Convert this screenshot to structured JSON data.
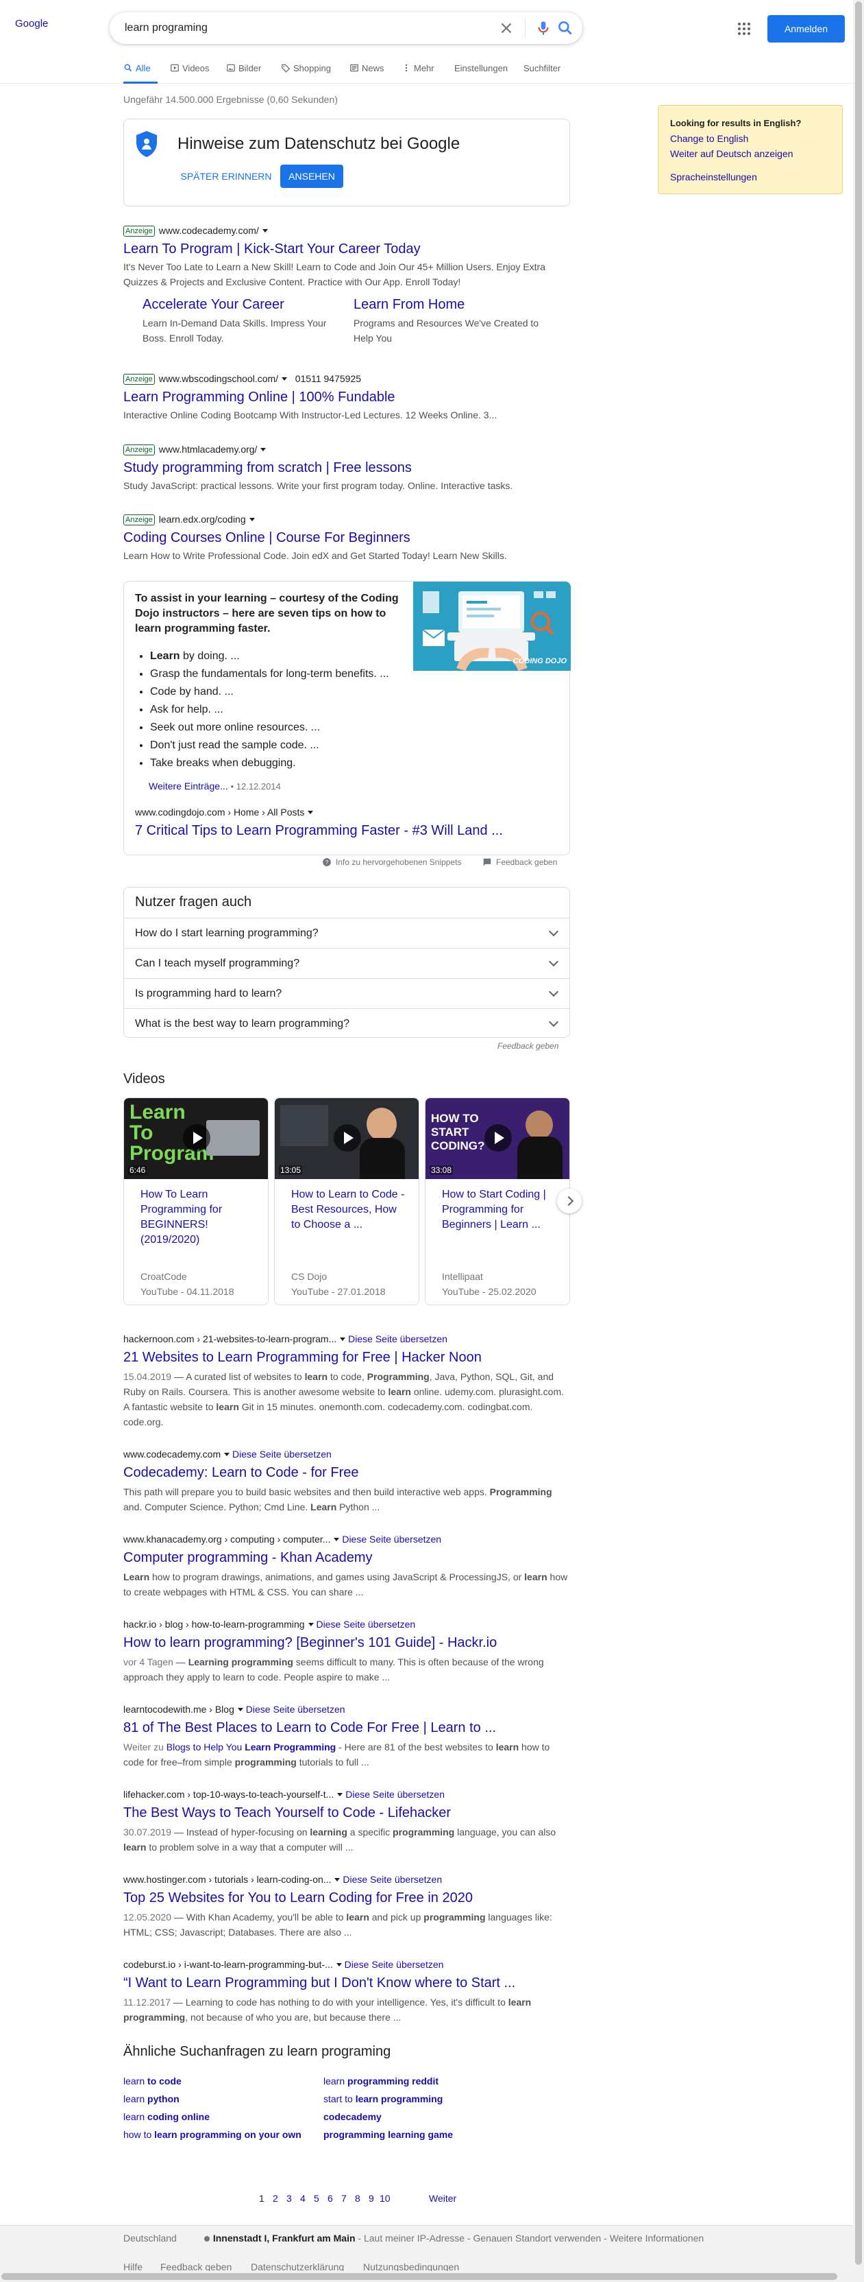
{
  "header": {
    "logo_alt": "Google",
    "query": "learn programing",
    "signin_label": "Anmelden"
  },
  "tabs": [
    {
      "label": "Alle"
    },
    {
      "label": "Videos"
    },
    {
      "label": "Bilder"
    },
    {
      "label": "Shopping"
    },
    {
      "label": "News"
    },
    {
      "label": "Mehr"
    },
    {
      "label": "Einstellungen"
    },
    {
      "label": "Suchfilter"
    }
  ],
  "stats": "Ungefähr 14.500.000 Ergebnisse (0,60 Sekunden)",
  "privacy": {
    "title": "Hinweise zum Datenschutz bei Google",
    "later": "SPÄTER ERINNERN",
    "view": "ANSEHEN"
  },
  "side_panel": {
    "title": "Looking for results in English?",
    "link1": "Change to English",
    "link2": "Weiter auf Deutsch anzeigen",
    "link3": "Spracheinstellungen"
  },
  "ads": [
    {
      "badge": "Anzeige",
      "url": "www.codecademy.com/",
      "phone": "",
      "title": "Learn To Program | Kick-Start Your Career Today",
      "desc": "It's Never Too Late to Learn a New Skill! Learn to Code and Join Our 45+ Million Users. Enjoy Extra Quizzes & Projects and Exclusive Content. Practice with Our App. Enroll Today!",
      "sitelinks": [
        {
          "title": "Accelerate Your Career",
          "desc": "Learn In-Demand Data Skills. Impress Your Boss. Enroll Today."
        },
        {
          "title": "Learn From Home",
          "desc": "Programs and Resources We've Created to Help You"
        }
      ]
    },
    {
      "badge": "Anzeige",
      "url": "www.wbscodingschool.com/",
      "phone": "01511 9475925",
      "title": "Learn Programming Online | 100% Fundable",
      "desc": "Interactive Online Coding Bootcamp With Instructor-Led Lectures. 12 Weeks Online. 3..."
    },
    {
      "badge": "Anzeige",
      "url": "www.htmlacademy.org/",
      "phone": "",
      "title": "Study programming from scratch | Free lessons",
      "desc": "Study JavaScript: practical lessons. Write your first program today. Online. Interactive tasks."
    },
    {
      "badge": "Anzeige",
      "url": "learn.edx.org/coding",
      "phone": "",
      "title": "Coding Courses Online | Course For Beginners",
      "desc": "Learn How to Write Professional Code. Join edX and Get Started Today! Learn New Skills."
    }
  ],
  "snippet": {
    "heading": "To assist in your learning – courtesy of the Coding Dojo instructors – here are seven tips on how to learn programming faster.",
    "tips": [
      "Learn by doing. ...",
      "Grasp the fundamentals for long-term benefits. ...",
      "Code by hand. ...",
      "Ask for help. ...",
      "Seek out more online resources. ...",
      "Don't just read the sample code. ...",
      "Take breaks when debugging."
    ],
    "more": "Weitere Einträge...",
    "date": "12.12.2014",
    "cite": "www.codingdojo.com › Home › All Posts",
    "link": "7 Critical Tips to Learn Programming Faster - #3 Will Land ...",
    "image_label": "CODING DOJO",
    "about": "Info zu hervorgehobenen Snippets",
    "feedback": "Feedback geben"
  },
  "paa": {
    "heading": "Nutzer fragen auch",
    "questions": [
      "How do I start learning programming?",
      "Can I teach myself programming?",
      "Is programming hard to learn?",
      "What is the best way to learn programming?"
    ],
    "feedback": "Feedback geben"
  },
  "videos": {
    "heading": "Videos",
    "items": [
      {
        "title": "How To Learn Programming for BEGINNERS! (2019/2020)",
        "channel": "CroatCode",
        "source": "YouTube",
        "date": "04.11.2018",
        "duration": "6:46",
        "thumb_text": "Learn To Program"
      },
      {
        "title": "How to Learn to Code - Best Resources, How to Choose a ...",
        "channel": "CS Dojo",
        "source": "YouTube",
        "date": "27.01.2018",
        "duration": "13:05",
        "thumb_text": ""
      },
      {
        "title": "How to Start Coding | Programming for Beginners | Learn ...",
        "channel": "Intellipaat",
        "source": "YouTube",
        "date": "25.02.2020",
        "duration": "33:08",
        "thumb_text": "HOW TO START CODING?"
      }
    ]
  },
  "results": [
    {
      "cite": "hackernoon.com › 21-websites-to-learn-program...",
      "translate": "Diese Seite übersetzen",
      "title": "21 Websites to Learn Programming for Free | Hacker Noon",
      "date": "15.04.2019",
      "desc": "A curated list of websites to learn to code, Programming, Java, Python, SQL, Git, and Ruby on Rails. Coursera. This is another awesome website to learn online. udemy.com. plurasight.com. A fantastic website to learn Git in 15 minutes. onemonth.com. codecademy.com. codingbat.com. code.org."
    },
    {
      "cite": "www.codecademy.com",
      "translate": "Diese Seite übersetzen",
      "title": "Codecademy: Learn to Code - for Free",
      "date": "",
      "desc": "This path will prepare you to build basic websites and then build interactive web apps. Programming and. Computer Science. Python; Cmd Line. Learn Python ..."
    },
    {
      "cite": "www.khanacademy.org › computing › computer...",
      "translate": "Diese Seite übersetzen",
      "title": "Computer programming - Khan Academy",
      "date": "",
      "desc": "Learn how to program drawings, animations, and games using JavaScript & ProcessingJS, or learn how to create webpages with HTML & CSS. You can share ..."
    },
    {
      "cite": "hackr.io › blog › how-to-learn-programming",
      "translate": "Diese Seite übersetzen",
      "title": "How to learn programming? [Beginner's 101 Guide] - Hackr.io",
      "date": "vor 4 Tagen",
      "desc": "Learning programming seems difficult to many. This is often because of the wrong approach they apply to learn to code. People aspire to make ..."
    },
    {
      "cite": "learntocodewith.me › Blog",
      "translate": "Diese Seite übersetzen",
      "title": "81 of The Best Places to Learn to Code For Free | Learn to ...",
      "date": "",
      "desc": "Weiter zu Blogs to Help You Learn Programming - Here are 81 of the best websites to learn how to code for free–from simple programming tutorials to full ..."
    },
    {
      "cite": "lifehacker.com › top-10-ways-to-teach-yourself-t...",
      "translate": "Diese Seite übersetzen",
      "title": "The Best Ways to Teach Yourself to Code - Lifehacker",
      "date": "30.07.2019",
      "desc": "Instead of hyper-focusing on learning a specific programming language, you can also learn to problem solve in a way that a computer will ..."
    },
    {
      "cite": "www.hostinger.com › tutorials › learn-coding-on...",
      "translate": "Diese Seite übersetzen",
      "title": "Top 25 Websites for You to Learn Coding for Free in 2020",
      "date": "12.05.2020",
      "desc": "With Khan Academy, you'll be able to learn and pick up programming languages like: HTML; CSS; Javascript; Databases. There are also ..."
    },
    {
      "cite": "codeburst.io › i-want-to-learn-programming-but-...",
      "translate": "Diese Seite übersetzen",
      "title": "“I Want to Learn Programming but I Don't Know where to Start ...",
      "date": "11.12.2017",
      "desc": "Learning to code has nothing to do with your intelligence. Yes, it's difficult to learn programming, not because of who you are, but because there ..."
    }
  ],
  "related": {
    "heading": "Ähnliche Suchanfragen zu learn programing",
    "items": [
      {
        "pre": "learn ",
        "bold": "to code"
      },
      {
        "pre": "learn ",
        "bold": "programming reddit"
      },
      {
        "pre": "learn ",
        "bold": "python"
      },
      {
        "pre": "start to ",
        "bold": "learn programming"
      },
      {
        "pre": "learn ",
        "bold": "coding online"
      },
      {
        "pre": "",
        "bold": "codecademy"
      },
      {
        "pre": "how to ",
        "bold": "learn programming on your own"
      },
      {
        "pre": "",
        "bold": "programming learning game"
      }
    ]
  },
  "pager": {
    "pages": [
      "1",
      "2",
      "3",
      "4",
      "5",
      "6",
      "7",
      "8",
      "9",
      "10"
    ],
    "next": "Weiter"
  },
  "footer": {
    "country": "Deutschland",
    "location": "Innenstadt I, Frankfurt am Main",
    "location_note": "- Laut meiner IP-Adresse - Genauen Standort verwenden - Weitere Informationen",
    "links": [
      "Hilfe",
      "Feedback geben",
      "Datenschutzerklärung",
      "Nutzungsbedingungen"
    ]
  },
  "colors": {
    "link": "#1a0dab",
    "accent": "#1a73e8",
    "ad_green": "#0d652d"
  }
}
